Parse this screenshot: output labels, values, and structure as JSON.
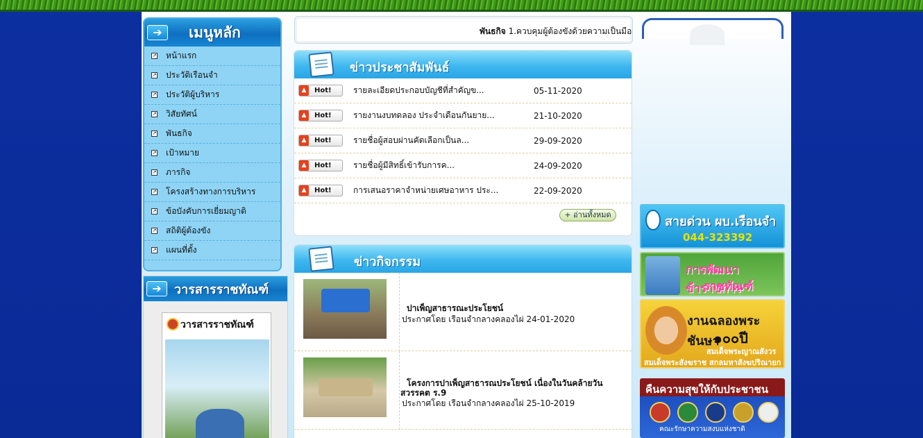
{
  "ticker": {
    "label": "พันธกิจ",
    "text": "1.ควบคุมผู้ต้องขังด้วยความเป็นมืออ"
  },
  "left_menu": {
    "title": "เมนูหลัก",
    "items": [
      "หน้าแรก",
      "ประวัติเรือนจำ",
      "ประวัติผู้บริหาร",
      "วิสัยทัศน์",
      "พันธกิจ",
      "เป้าหมาย",
      "ภารกิจ",
      "โครงสร้างทางการบริหาร",
      "ข้อบังคับการเยี่ยมญาติ",
      "สถิติผู้ต้องขัง",
      "แผนที่ตั้ง"
    ]
  },
  "journal": {
    "title": "วารสารราชทัณฑ์",
    "cover_title": "วารสารราชทัณฑ์"
  },
  "news": {
    "title": "ข่าวประชาสัมพันธ์",
    "badge": "Hot!",
    "rows": [
      {
        "title": "รายละเอียดประกอบบัญชีที่สำคัญข...",
        "date": "05-11-2020"
      },
      {
        "title": "รายงานงบทดลอง ประจำเดือนกันยาย...",
        "date": "21-10-2020"
      },
      {
        "title": "รายชื่อผู้สอบผ่านคัดเลือกเป็นล...",
        "date": "29-09-2020"
      },
      {
        "title": "รายชื่อผู้มีสิทธิ์เข้ารับการค...",
        "date": "24-09-2020"
      },
      {
        "title": "การเสนอราคาจำหน่ายเศษอาหาร ประ...",
        "date": "22-09-2020"
      }
    ],
    "read_all": "+ อ่านทั้งหมด"
  },
  "activities": {
    "title": "ข่าวกิจกรรม",
    "items": [
      {
        "title": "ปาเพ็ญสาธารณะประโยชน์",
        "title2": "",
        "meta": "ประกาศโดย เรือนจำกลางคลองไผ่  24-01-2020"
      },
      {
        "title": "โครงการปาเพ็ญสาธารณประโยชน์ เนื่องในวันคล้ายวัน",
        "title2": "สวรรคต ร.9",
        "meta": "ประกาศโดย เรือนจำกลางคลองไผ่  25-10-2019"
      }
    ]
  },
  "banners": {
    "hotline": {
      "line1": "สายด่วน ผบ.เรือนจำ",
      "phone": "044-323392"
    },
    "develop": {
      "line1": "การพัฒนาข้าราชการ",
      "line2": "ราชทัณฑ์"
    },
    "celebrate": {
      "line1": "งานฉลองพระชันษา",
      "line2": "๑๐๐ปี",
      "line3": "สมเด็จพระญาณสังวร",
      "line4": "สมเด็จพระสังฆราช สกลมหาสังฆปริณายก"
    },
    "happiness": {
      "line1": "คืนความสุขให้กับประชาชน",
      "line2": "คณะรักษาความสงบแห่งชาติ"
    }
  },
  "colors": {
    "page_bg": "#0a2a96",
    "menu_bg": "#8fd4f5",
    "header_blue": "#1687d2"
  }
}
